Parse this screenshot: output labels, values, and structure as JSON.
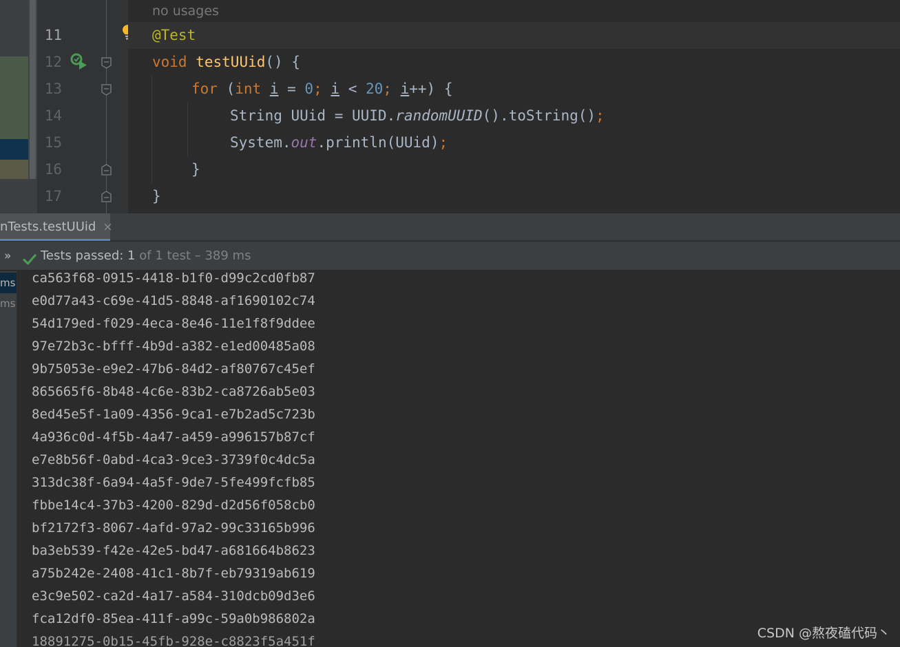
{
  "editor": {
    "hint": "no usages",
    "lines": [
      {
        "num": "11"
      },
      {
        "num": "12"
      },
      {
        "num": "13"
      },
      {
        "num": "14"
      },
      {
        "num": "15"
      },
      {
        "num": "16"
      },
      {
        "num": "17"
      }
    ],
    "code": {
      "l11_annotation": "@Test",
      "l12_kw": "void",
      "l12_method": "testUUid",
      "l12_rest": "() {",
      "l13_for": "for",
      "l13_open": " (",
      "l13_int": "int",
      "l13_sp": " ",
      "l13_i1": "i",
      "l13_eq": " = ",
      "l13_zero": "0",
      "l13_semi1": ";",
      "l13_sp2": " ",
      "l13_i2": "i",
      "l13_lt": " < ",
      "l13_twenty": "20",
      "l13_semi2": ";",
      "l13_sp3": " ",
      "l13_i3": "i",
      "l13_end": "++) {",
      "l14_a": "String UUid = UUID.",
      "l14_method": "randomUUID",
      "l14_b": "().toString()",
      "l14_semi": ";",
      "l15_a": "System.",
      "l15_field": "out",
      "l15_b": ".println(UUid)",
      "l15_semi": ";",
      "l16": "}",
      "l17": "}"
    },
    "icons": {
      "bulb": "lightbulb-icon",
      "run": "run-test-icon",
      "fold": "fold-marker-icon"
    },
    "colors": {
      "keyword": "#cc7832",
      "annotation": "#bbb529",
      "method": "#ffc66d",
      "number": "#6897bb",
      "field": "#9876aa",
      "text": "#a9b7c6"
    }
  },
  "run_panel": {
    "tab_label": "nTests.testUUid",
    "tab_close": "×",
    "chevron": "»",
    "status_main": "Tests passed: ",
    "status_count": "1",
    "status_rest": " of 1 test – 389 ms",
    "tree_item_1": "ms",
    "tree_item_2": "ms",
    "success_color": "#499c54"
  },
  "console": {
    "lines": [
      "ca563f68-0915-4418-b1f0-d99c2cd0fb87",
      "e0d77a43-c69e-41d5-8848-af1690102c74",
      "54d179ed-f029-4eca-8e46-11e1f8f9ddee",
      "97e72b3c-bfff-4b9d-a382-e1ed00485a08",
      "9b75053e-e9e2-47b6-84d2-af80767c45ef",
      "865665f6-8b48-4c6e-83b2-ca8726ab5e03",
      "8ed45e5f-1a09-4356-9ca1-e7b2ad5c723b",
      "4a936c0d-4f5b-4a47-a459-a996157b87cf",
      "e7e8b56f-0abd-4ca3-9ce3-3739f0c4dc5a",
      "313dc38f-6a94-4a5f-9de7-5fe499fcfb85",
      "fbbe14c4-37b3-4200-829d-d2d56f058cb0",
      "bf2172f3-8067-4afd-97a2-99c33165b996",
      "ba3eb539-f42e-42e5-bd47-a681664b8623",
      "a75b242e-2408-41c1-8b7f-eb79319ab619",
      "e3c9e502-ca2d-4a17-a584-310dcb09d3e6",
      "fca12df0-85ea-411f-a99c-59a0b986802a"
    ],
    "partial_line": "18891275-0b15-45fb-928e-c8823f5a451f"
  },
  "watermark": "CSDN @熬夜磕代码丶"
}
